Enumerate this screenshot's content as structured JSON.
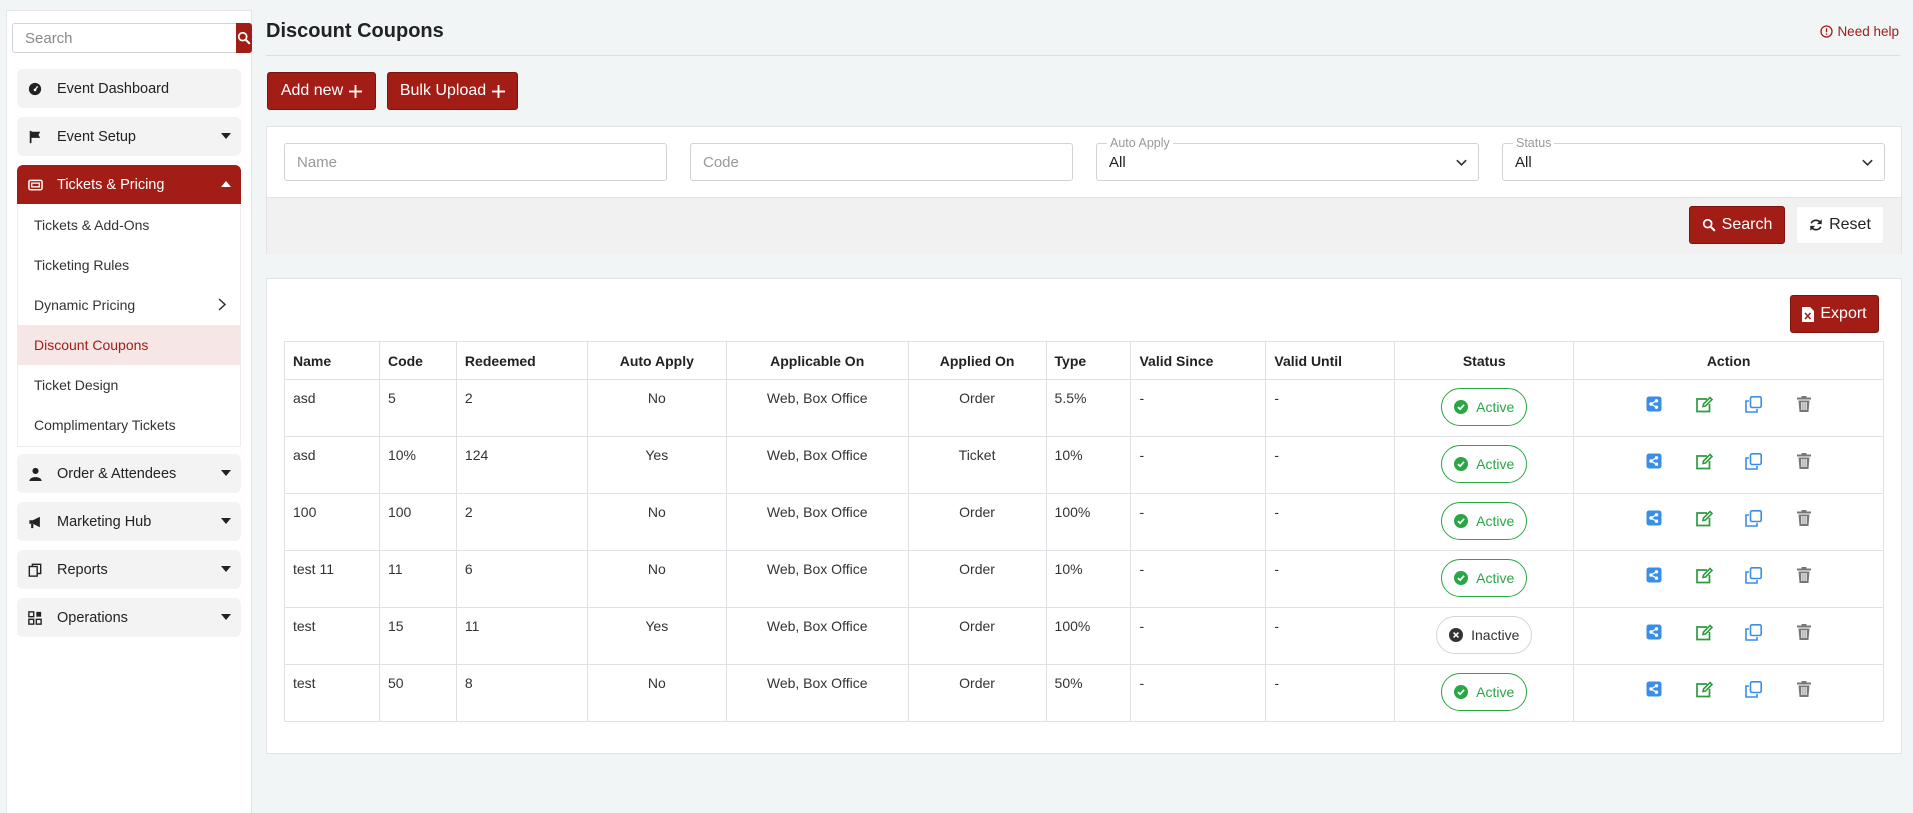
{
  "sidebar": {
    "search_placeholder": "Search",
    "nav": [
      {
        "label": "Event Dashboard",
        "icon": "dashboard-icon"
      },
      {
        "label": "Event Setup",
        "icon": "flag-icon"
      },
      {
        "label": "Tickets & Pricing",
        "icon": "ticket-icon"
      },
      {
        "label": "Order & Attendees",
        "icon": "user-icon"
      },
      {
        "label": "Marketing Hub",
        "icon": "megaphone-icon"
      },
      {
        "label": "Reports",
        "icon": "reports-icon"
      },
      {
        "label": "Operations",
        "icon": "operations-icon"
      }
    ],
    "sub_items": [
      {
        "label": "Tickets & Add-Ons"
      },
      {
        "label": "Ticketing Rules"
      },
      {
        "label": "Dynamic Pricing"
      },
      {
        "label": "Discount Coupons"
      },
      {
        "label": "Ticket Design"
      },
      {
        "label": "Complimentary Tickets"
      }
    ]
  },
  "header": {
    "title": "Discount Coupons",
    "help": "Need help"
  },
  "toolbar": {
    "add_new": "Add new",
    "bulk_upload": "Bulk Upload"
  },
  "filters": {
    "name_placeholder": "Name",
    "code_placeholder": "Code",
    "auto_apply_label": "Auto Apply",
    "auto_apply_value": "All",
    "status_label": "Status",
    "status_value": "All",
    "search_btn": "Search",
    "reset_btn": "Reset"
  },
  "table": {
    "export": "Export",
    "columns": [
      "Name",
      "Code",
      "Redeemed",
      "Auto Apply",
      "Applicable On",
      "Applied On",
      "Type",
      "Valid Since",
      "Valid Until",
      "Status",
      "Action"
    ],
    "rows": [
      {
        "name": "asd",
        "code": "5",
        "redeemed": "2",
        "auto_apply": "No",
        "applicable_on": "Web, Box Office",
        "applied_on": "Order",
        "type": "5.5%",
        "valid_since": "-",
        "valid_until": "-",
        "status": "Active"
      },
      {
        "name": "asd",
        "code": "10%",
        "redeemed": "124",
        "auto_apply": "Yes",
        "applicable_on": "Web, Box Office",
        "applied_on": "Ticket",
        "type": "10%",
        "valid_since": "-",
        "valid_until": "-",
        "status": "Active"
      },
      {
        "name": "100",
        "code": "100",
        "redeemed": "2",
        "auto_apply": "No",
        "applicable_on": "Web, Box Office",
        "applied_on": "Order",
        "type": "100%",
        "valid_since": "-",
        "valid_until": "-",
        "status": "Active"
      },
      {
        "name": "test 11",
        "code": "11",
        "redeemed": "6",
        "auto_apply": "No",
        "applicable_on": "Web, Box Office",
        "applied_on": "Order",
        "type": "10%",
        "valid_since": "-",
        "valid_until": "-",
        "status": "Active"
      },
      {
        "name": "test",
        "code": "15",
        "redeemed": "11",
        "auto_apply": "Yes",
        "applicable_on": "Web, Box Office",
        "applied_on": "Order",
        "type": "100%",
        "valid_since": "-",
        "valid_until": "-",
        "status": "Inactive"
      },
      {
        "name": "test",
        "code": "50",
        "redeemed": "8",
        "auto_apply": "No",
        "applicable_on": "Web, Box Office",
        "applied_on": "Order",
        "type": "50%",
        "valid_since": "-",
        "valid_until": "-",
        "status": "Active"
      }
    ]
  },
  "colors": {
    "brand": "#a11d15",
    "active": "#28a745",
    "action_blue": "#3a8ee6",
    "action_green": "#2e9b3e"
  }
}
